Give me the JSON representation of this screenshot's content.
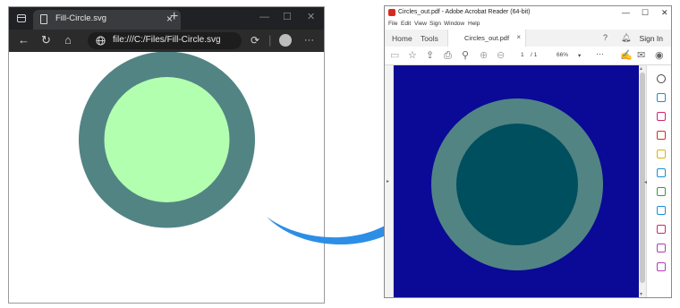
{
  "browser": {
    "tab_title": "Fill-Circle.svg",
    "tab_close": "×",
    "new_tab": "+",
    "address": "file:///C:/Files/Fill-Circle.svg",
    "more": "···"
  },
  "svg_drawing": {
    "outer_fill": "#528484",
    "inner_fill": "#b3ffb0"
  },
  "arrow": {
    "color": "#2d8ee6"
  },
  "acrobat": {
    "title": "Circles_out.pdf - Adobe Acrobat Reader (64-bit)",
    "menus": [
      "File",
      "Edit",
      "View",
      "Sign",
      "Window",
      "Help"
    ],
    "tabs": {
      "home": "Home",
      "tools": "Tools",
      "document": "Circles_out.pdf",
      "close": "×"
    },
    "sign_in": "Sign In",
    "page_current": "1",
    "page_total": "/ 1",
    "zoom": "66%",
    "more": "···",
    "doc_background": "#0a0a96",
    "outer_fill": "#528484",
    "inner_fill": "#004f5e",
    "right_panel_icon_colors": [
      "#444444",
      "#1a8fd8",
      "#d3246d",
      "#d62a20",
      "#e0b200",
      "#1a8fd8",
      "#3a9a3a",
      "#1a8fd8",
      "#d3246d",
      "#b13db1",
      "#b13db1"
    ]
  }
}
